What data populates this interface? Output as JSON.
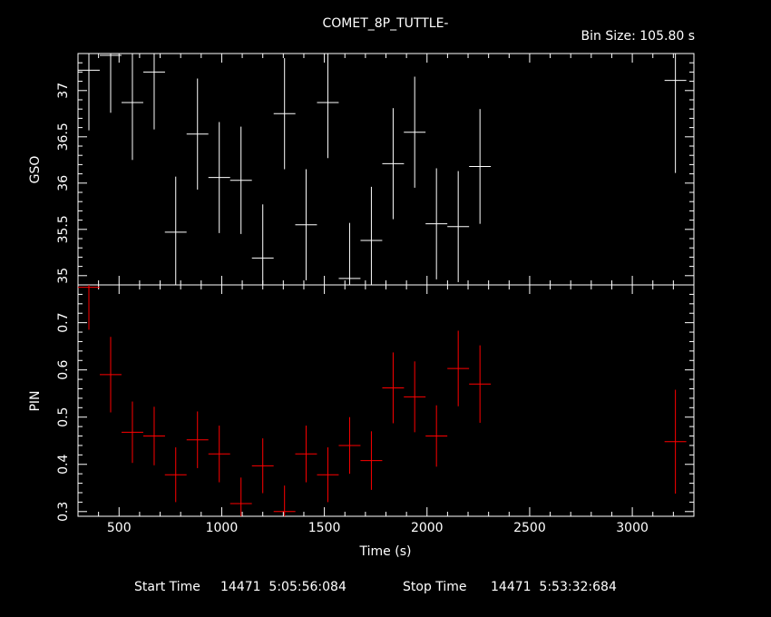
{
  "title": "COMET_8P_TUTTLE-",
  "bin_size": "Bin Size: 105.80 s",
  "footer": {
    "start_label": "Start Time",
    "start_value": "14471  5:05:56:084",
    "stop_label": "Stop Time",
    "stop_value": "14471  5:53:32:684"
  },
  "colors": {
    "gso": "#ffffff",
    "pin": "#ff0000",
    "axes": "#ffffff",
    "background": "#000000"
  },
  "chart_data": [
    {
      "type": "scatter",
      "panel": "top",
      "ylabel": "GSO",
      "xlim": [
        300,
        3300
      ],
      "ylim": [
        34.9,
        37.4
      ],
      "x_ticks": [
        500,
        1000,
        1500,
        2000,
        2500,
        3000
      ],
      "y_ticks": [
        35,
        35.5,
        36,
        36.5,
        37
      ],
      "y_tick_labels": [
        "35",
        "35.5",
        "36",
        "36.5",
        "37"
      ],
      "x_error_halfwidth": 52.9,
      "series": [
        {
          "x": [
            353,
            459,
            565,
            671,
            776,
            882,
            988,
            1094,
            1200,
            1306,
            1411,
            1517,
            1623,
            1729,
            1835,
            1940,
            2046,
            2152,
            2258,
            3210
          ],
          "y": [
            37.22,
            37.38,
            36.87,
            37.2,
            35.47,
            36.53,
            36.06,
            36.03,
            35.19,
            36.75,
            35.55,
            36.87,
            34.97,
            35.38,
            36.21,
            36.55,
            35.56,
            35.53,
            36.18,
            37.11
          ],
          "yerr": [
            0.65,
            0.62,
            0.62,
            0.62,
            0.6,
            0.6,
            0.6,
            0.58,
            0.58,
            0.6,
            0.6,
            0.6,
            0.6,
            0.58,
            0.6,
            0.6,
            0.6,
            0.6,
            0.62,
            1.0
          ]
        }
      ]
    },
    {
      "type": "scatter",
      "panel": "bottom",
      "xlabel": "Time (s)",
      "ylabel": "PIN",
      "xlim": [
        300,
        3300
      ],
      "ylim": [
        0.29,
        0.78
      ],
      "x_ticks": [
        500,
        1000,
        1500,
        2000,
        2500,
        3000
      ],
      "x_tick_labels": [
        "500",
        "1000",
        "1500",
        "2000",
        "2500",
        "3000"
      ],
      "y_ticks": [
        0.3,
        0.4,
        0.5,
        0.6,
        0.7
      ],
      "y_tick_labels": [
        "0.3",
        "0.4",
        "0.5",
        "0.6",
        "0.7"
      ],
      "x_error_halfwidth": 52.9,
      "series": [
        {
          "x": [
            353,
            459,
            565,
            671,
            776,
            882,
            988,
            1094,
            1200,
            1306,
            1411,
            1517,
            1623,
            1729,
            1835,
            1940,
            2046,
            2152,
            2258,
            3210
          ],
          "y": [
            0.775,
            0.59,
            0.468,
            0.46,
            0.378,
            0.452,
            0.422,
            0.317,
            0.397,
            0.3,
            0.422,
            0.378,
            0.44,
            0.408,
            0.562,
            0.543,
            0.46,
            0.603,
            0.57,
            0.448
          ],
          "yerr": [
            0.09,
            0.08,
            0.065,
            0.062,
            0.058,
            0.06,
            0.06,
            0.055,
            0.058,
            0.055,
            0.06,
            0.058,
            0.06,
            0.062,
            0.075,
            0.075,
            0.065,
            0.08,
            0.082,
            0.11
          ]
        }
      ]
    }
  ]
}
